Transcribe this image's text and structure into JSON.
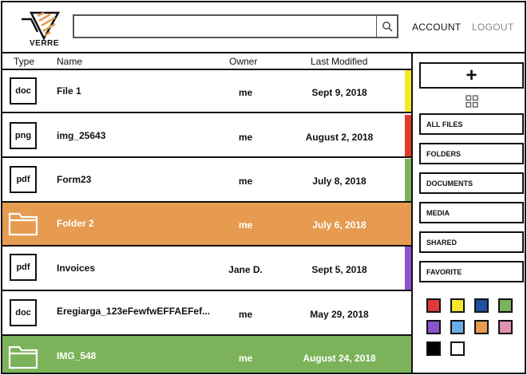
{
  "header": {
    "logo_text": "VERRE",
    "search": {
      "value": "",
      "placeholder": ""
    },
    "account_label": "ACCOUNT",
    "logout_label": "LOGOUT"
  },
  "table": {
    "columns": [
      "Type",
      "Name",
      "Owner",
      "Last Modified"
    ],
    "rows": [
      {
        "type": "doc",
        "name": "File 1",
        "owner": "me",
        "modified": "Sept 9, 2018",
        "tag_color": "#f5e82a"
      },
      {
        "type": "png",
        "name": "img_25643",
        "owner": "me",
        "modified": "August 2, 2018",
        "tag_color": "#e03a2a"
      },
      {
        "type": "pdf",
        "name": "Form23",
        "owner": "me",
        "modified": "July 8, 2018",
        "tag_color": "#7cb35a"
      },
      {
        "type": "folder",
        "name": "Folder 2",
        "owner": "me",
        "modified": "July 6, 2018",
        "tag_color": "#e69b50"
      },
      {
        "type": "pdf",
        "name": "Invoices",
        "owner": "Jane D.",
        "modified": "Sept 5, 2018",
        "tag_color": "#8a55cc"
      },
      {
        "type": "doc",
        "name": "Eregiarga_123eFewfwEFFAEFef...",
        "owner": "me",
        "modified": "May 29, 2018",
        "tag_color": "#ffffff"
      },
      {
        "type": "folder",
        "name": "IMG_548",
        "owner": "me",
        "modified": "August 24, 2018",
        "tag_color": "#7cb35a"
      }
    ]
  },
  "sidebar": {
    "new_label": "+",
    "filters": [
      "ALL FILES",
      "FOLDERS",
      "DOCUMENTS",
      "MEDIA",
      "SHARED",
      "FAVORITE"
    ],
    "color_swatches": [
      "#e03a3a",
      "#f5e82a",
      "#1f4fa0",
      "#7cb35a",
      "#8a55cc",
      "#6aaee8",
      "#e69b50",
      "#e090b0",
      "#000000",
      "#ffffff"
    ]
  },
  "colors": {
    "highlight_orange": "#e69b50",
    "highlight_green": "#7cb35a"
  }
}
